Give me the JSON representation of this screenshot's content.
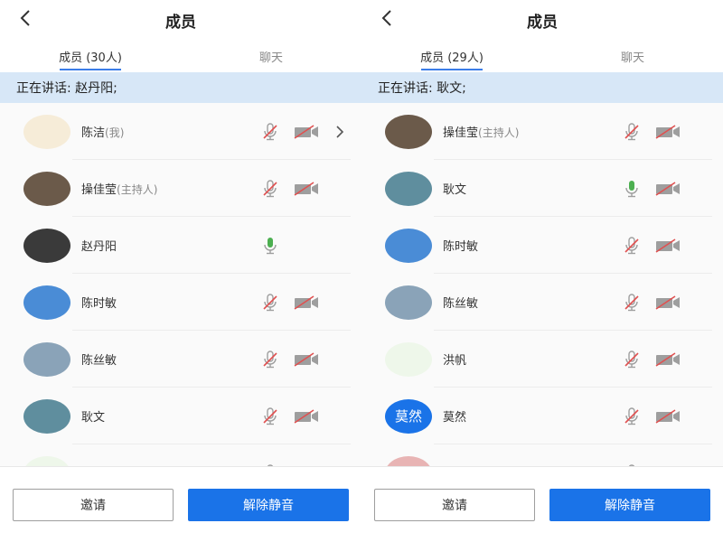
{
  "left": {
    "header": {
      "title": "成员"
    },
    "tabs": [
      {
        "label": "成员 (30人)"
      },
      {
        "label": "聊天"
      }
    ],
    "banner": "正在讲话: 赵丹阳;",
    "members": [
      {
        "name": "陈洁",
        "tag": "(我)",
        "mic": "muted",
        "cam": "off",
        "chevron": true,
        "avatar_color": "#f6ecd8"
      },
      {
        "name": "操佳莹",
        "tag": "(主持人)",
        "mic": "muted",
        "cam": "off",
        "chevron": false,
        "avatar_color": "#6b5a4a"
      },
      {
        "name": "赵丹阳",
        "tag": "",
        "mic": "active",
        "cam": "none",
        "chevron": false,
        "avatar_color": "#3a3a3a"
      },
      {
        "name": "陈时敏",
        "tag": "",
        "mic": "muted",
        "cam": "off",
        "chevron": false,
        "avatar_color": "#4a8cd6"
      },
      {
        "name": "陈丝敏",
        "tag": "",
        "mic": "muted",
        "cam": "off",
        "chevron": false,
        "avatar_color": "#8aa3b8"
      },
      {
        "name": "耿文",
        "tag": "",
        "mic": "muted",
        "cam": "off",
        "chevron": false,
        "avatar_color": "#5f8e9e"
      },
      {
        "name": "",
        "tag": "",
        "mic": "muted",
        "cam": "off",
        "chevron": false,
        "avatar_color": "#eef7ea"
      }
    ],
    "footer": {
      "invite": "邀请",
      "unmute": "解除静音"
    }
  },
  "right": {
    "header": {
      "title": "成员"
    },
    "tabs": [
      {
        "label": "成员 (29人)"
      },
      {
        "label": "聊天"
      }
    ],
    "banner": "正在讲话: 耿文;",
    "members": [
      {
        "name": "操佳莹",
        "tag": "(主持人)",
        "mic": "muted",
        "cam": "off",
        "chevron": false,
        "avatar_color": "#6b5a4a"
      },
      {
        "name": "耿文",
        "tag": "",
        "mic": "active",
        "cam": "off",
        "chevron": false,
        "avatar_color": "#5f8e9e"
      },
      {
        "name": "陈时敏",
        "tag": "",
        "mic": "muted",
        "cam": "off",
        "chevron": false,
        "avatar_color": "#4a8cd6"
      },
      {
        "name": "陈丝敏",
        "tag": "",
        "mic": "muted",
        "cam": "off",
        "chevron": false,
        "avatar_color": "#8aa3b8"
      },
      {
        "name": "洪帆",
        "tag": "",
        "mic": "muted",
        "cam": "off",
        "chevron": false,
        "avatar_color": "#eef7ea"
      },
      {
        "name": "莫然",
        "tag": "",
        "mic": "muted",
        "cam": "off",
        "chevron": false,
        "avatar_color": "#1a73e8",
        "avatar_text": "莫然"
      },
      {
        "name": "",
        "tag": "",
        "mic": "muted",
        "cam": "off",
        "chevron": false,
        "avatar_color": "#e8b4b4"
      }
    ],
    "footer": {
      "invite": "邀请",
      "unmute": "解除静音"
    }
  },
  "colors": {
    "accent": "#1a73e8",
    "banner_bg": "#d7e7f7",
    "mic_active": "#4caf50",
    "muted_red": "#e05050"
  }
}
